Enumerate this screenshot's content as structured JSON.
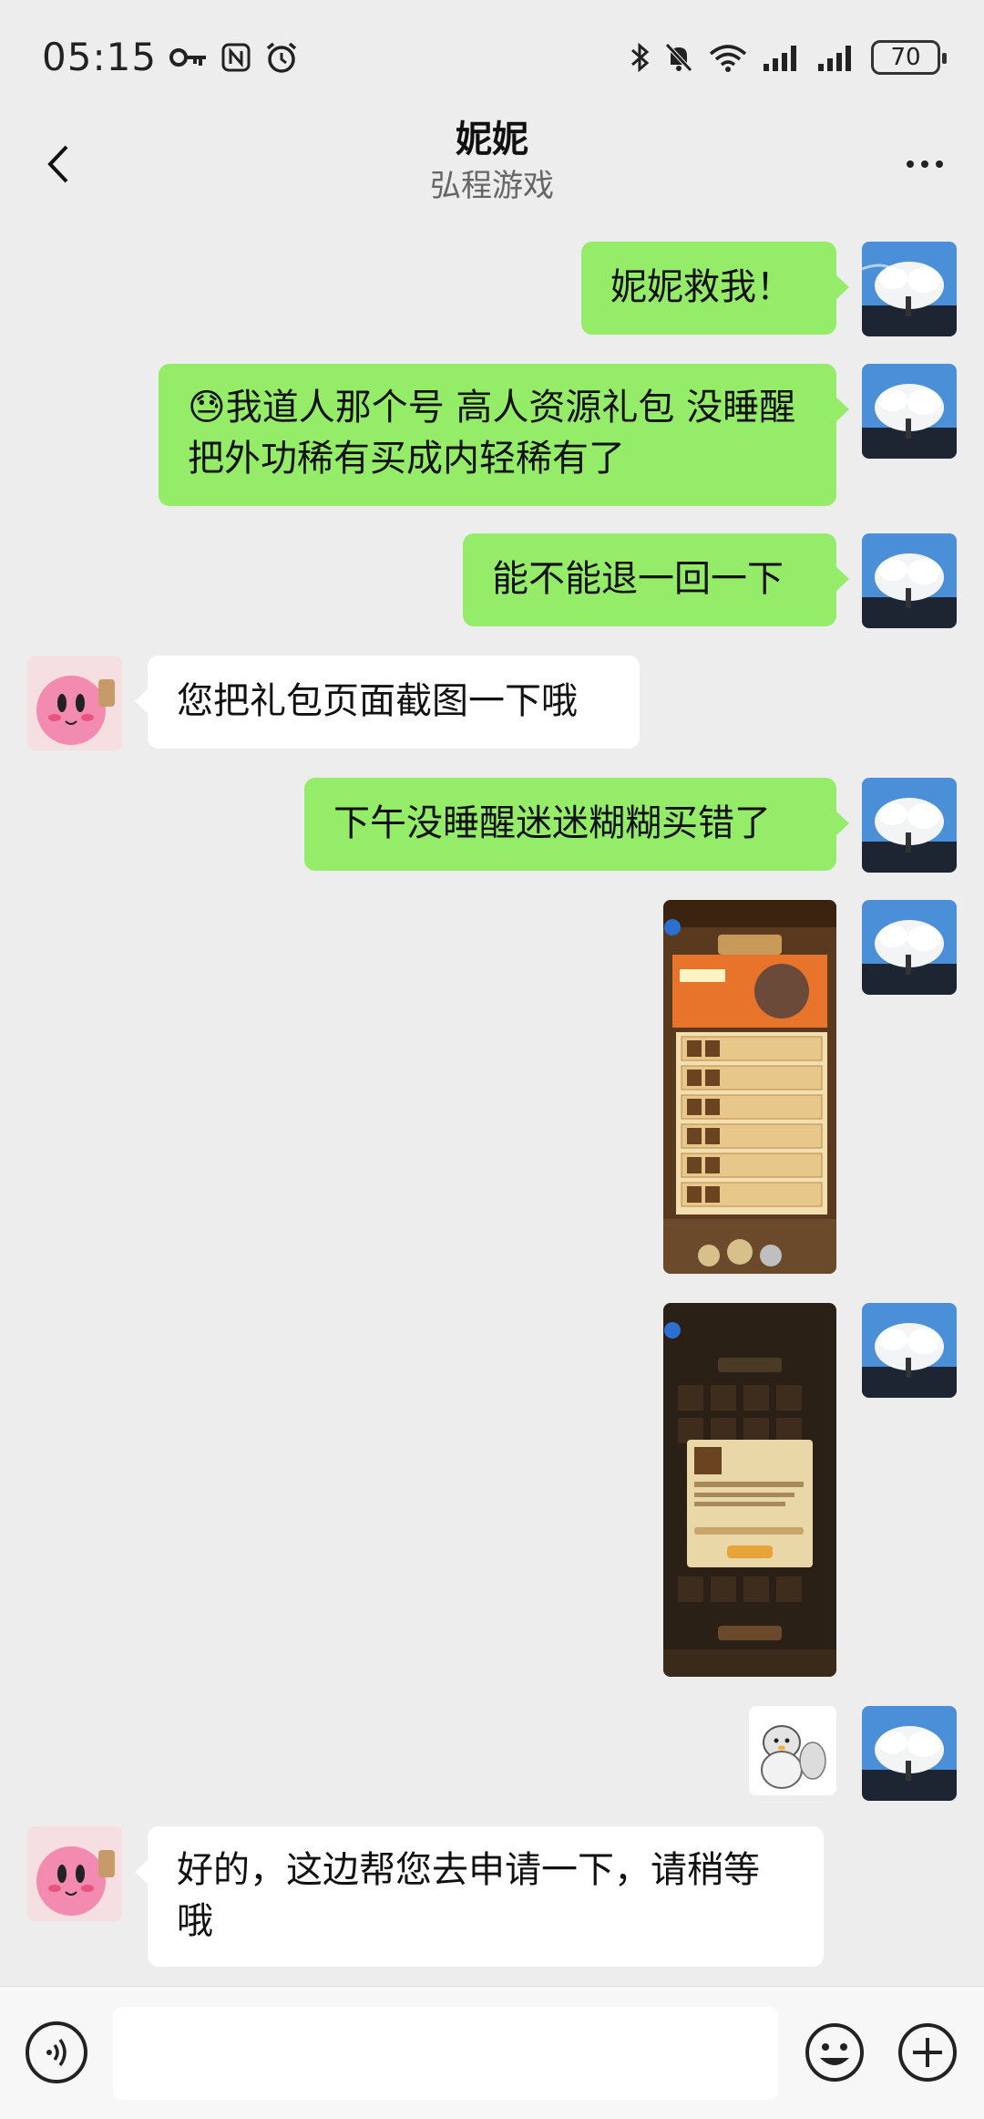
{
  "status_bar": {
    "time": "05:15",
    "left_icons": [
      "key-icon",
      "nfc-icon",
      "alarm-icon"
    ],
    "right_icons": [
      "bluetooth-icon",
      "mute-icon",
      "wifi-icon",
      "signal-icon",
      "signal-icon"
    ],
    "battery": "70"
  },
  "header": {
    "title": "妮妮",
    "subtitle": "弘程游戏"
  },
  "messages": [
    {
      "sender": "me",
      "type": "text",
      "text": "妮妮救我！"
    },
    {
      "sender": "me",
      "type": "text",
      "emoji": "😓",
      "text": "我道人那个号  高人资源礼包  没睡醒把外功稀有买成内轻稀有了"
    },
    {
      "sender": "me",
      "type": "text",
      "text": "能不能退一回一下"
    },
    {
      "sender": "other",
      "type": "text",
      "text": "您把礼包页面截图一下哦"
    },
    {
      "sender": "me",
      "type": "text",
      "text": "下午没睡醒迷迷糊糊买错了"
    },
    {
      "sender": "me",
      "type": "image",
      "image": "game-gift-page-screenshot"
    },
    {
      "sender": "me",
      "type": "image",
      "image": "game-inventory-screenshot"
    },
    {
      "sender": "me",
      "type": "sticker",
      "image": "penguin-sticker"
    },
    {
      "sender": "other",
      "type": "text",
      "text": "好的，这边帮您去申请一下，请稍等哦"
    }
  ],
  "input_bar": {
    "placeholder": "",
    "icons": [
      "voice-icon",
      "emoji-icon",
      "plus-icon"
    ]
  },
  "colors": {
    "background": "#ededed",
    "my_bubble": "#95ec69",
    "other_bubble": "#ffffff"
  }
}
